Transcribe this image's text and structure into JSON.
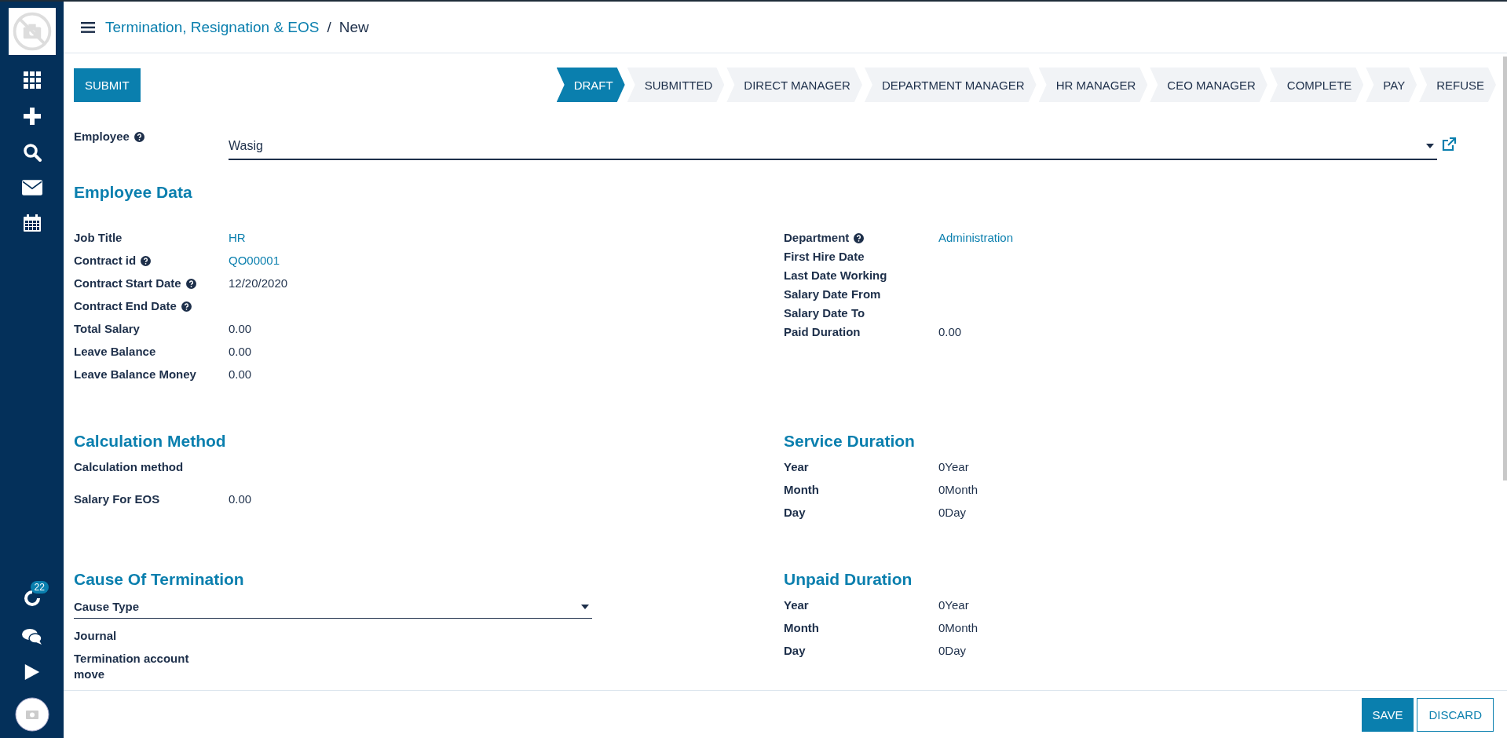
{
  "breadcrumb": {
    "parent": "Termination, Resignation & EOS",
    "separator": "/",
    "current": "New"
  },
  "sidebar": {
    "badge": "22"
  },
  "header_buttons": [
    "SUBMIT"
  ],
  "stages": [
    {
      "label": "DRAFT",
      "selected": true
    },
    {
      "label": "SUBMITTED",
      "selected": false
    },
    {
      "label": "DIRECT MANAGER",
      "selected": false
    },
    {
      "label": "DEPARTMENT MANAGER",
      "selected": false
    },
    {
      "label": "HR MANAGER",
      "selected": false
    },
    {
      "label": "CEO MANAGER",
      "selected": false
    },
    {
      "label": "COMPLETE",
      "selected": false
    },
    {
      "label": "PAY",
      "selected": false
    },
    {
      "label": "REFUSE",
      "selected": false
    }
  ],
  "employee": {
    "label": "Employee",
    "help": true,
    "value": "Wasig"
  },
  "sections": [
    {
      "left": {
        "title": "Employee Data",
        "fields": [
          {
            "label": "Job Title",
            "help": false,
            "kind": "link",
            "value": "HR"
          },
          {
            "label": "Contract id",
            "help": true,
            "kind": "link",
            "value": "QO00001"
          },
          {
            "label": "Contract Start Date",
            "help": true,
            "kind": "text",
            "value": "12/20/2020"
          },
          {
            "label": "Contract End Date",
            "help": true,
            "kind": "text"
          },
          {
            "label": "Total Salary",
            "help": false,
            "kind": "text",
            "value": "0.00"
          },
          {
            "label": "Leave Balance",
            "help": false,
            "kind": "text",
            "value": "0.00"
          },
          {
            "label": "Leave Balance Money",
            "help": false,
            "kind": "text",
            "value": "0.00"
          }
        ]
      },
      "right": {
        "fields": [
          {
            "label": "Department",
            "help": true,
            "kind": "link",
            "value": "Administration"
          },
          {
            "label": "First Hire Date",
            "help": false,
            "kind": "text"
          },
          {
            "label": "Last Date Working",
            "help": false,
            "kind": "text"
          },
          {
            "label": "Salary Date From",
            "help": false,
            "kind": "text"
          },
          {
            "label": "Salary Date To",
            "help": false,
            "kind": "text"
          },
          {
            "label": "Paid Duration",
            "help": false,
            "kind": "text",
            "value": "0.00"
          }
        ]
      }
    },
    {
      "left": {
        "title": "Calculation Method",
        "fields": [
          {
            "label": "Calculation method",
            "help": false,
            "kind": "text"
          },
          {
            "label": "Salary For EOS",
            "help": false,
            "kind": "text",
            "value": "0.00"
          }
        ]
      },
      "right": {
        "title": "Service Duration",
        "fields": [
          {
            "label": "Year",
            "help": false,
            "kind": "text",
            "value": "0Year"
          },
          {
            "label": "Month",
            "help": false,
            "kind": "text",
            "value": "0Month"
          },
          {
            "label": "Day",
            "help": false,
            "kind": "text",
            "value": "0Day"
          }
        ]
      }
    },
    {
      "left": {
        "title": "Cause Of Termination",
        "fields": [
          {
            "label": "Cause Type",
            "help": false,
            "kind": "select"
          },
          {
            "label": "Journal",
            "help": false,
            "kind": "text"
          },
          {
            "label": "Termination account move",
            "help": false,
            "kind": "text"
          }
        ]
      },
      "right": {
        "title": "Unpaid Duration",
        "fields": [
          {
            "label": "Year",
            "help": false,
            "kind": "text",
            "value": "0Year"
          },
          {
            "label": "Month",
            "help": false,
            "kind": "text",
            "value": "0Month"
          },
          {
            "label": "Day",
            "help": false,
            "kind": "text",
            "value": "0Day"
          }
        ]
      }
    }
  ],
  "footer_buttons": [
    {
      "label": "SAVE",
      "kind": "primary"
    },
    {
      "label": "DISCARD",
      "kind": "secondary"
    }
  ]
}
